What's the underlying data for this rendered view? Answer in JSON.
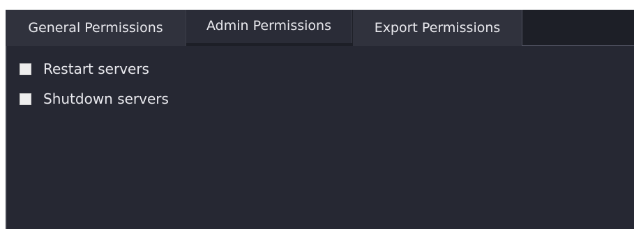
{
  "tabs": [
    {
      "label": "General Permissions"
    },
    {
      "label": "Admin Permissions",
      "active": true
    },
    {
      "label": "Export Permissions"
    }
  ],
  "options": [
    {
      "label": "Restart servers",
      "checked": false
    },
    {
      "label": "Shutdown servers",
      "checked": false
    }
  ],
  "colors": {
    "panel_background": "#262833",
    "tab_background": "#30323d",
    "active_tab_background": "#2a2c37",
    "text": "#e9e9ee",
    "checkbox_fill": "#eeeeee"
  }
}
